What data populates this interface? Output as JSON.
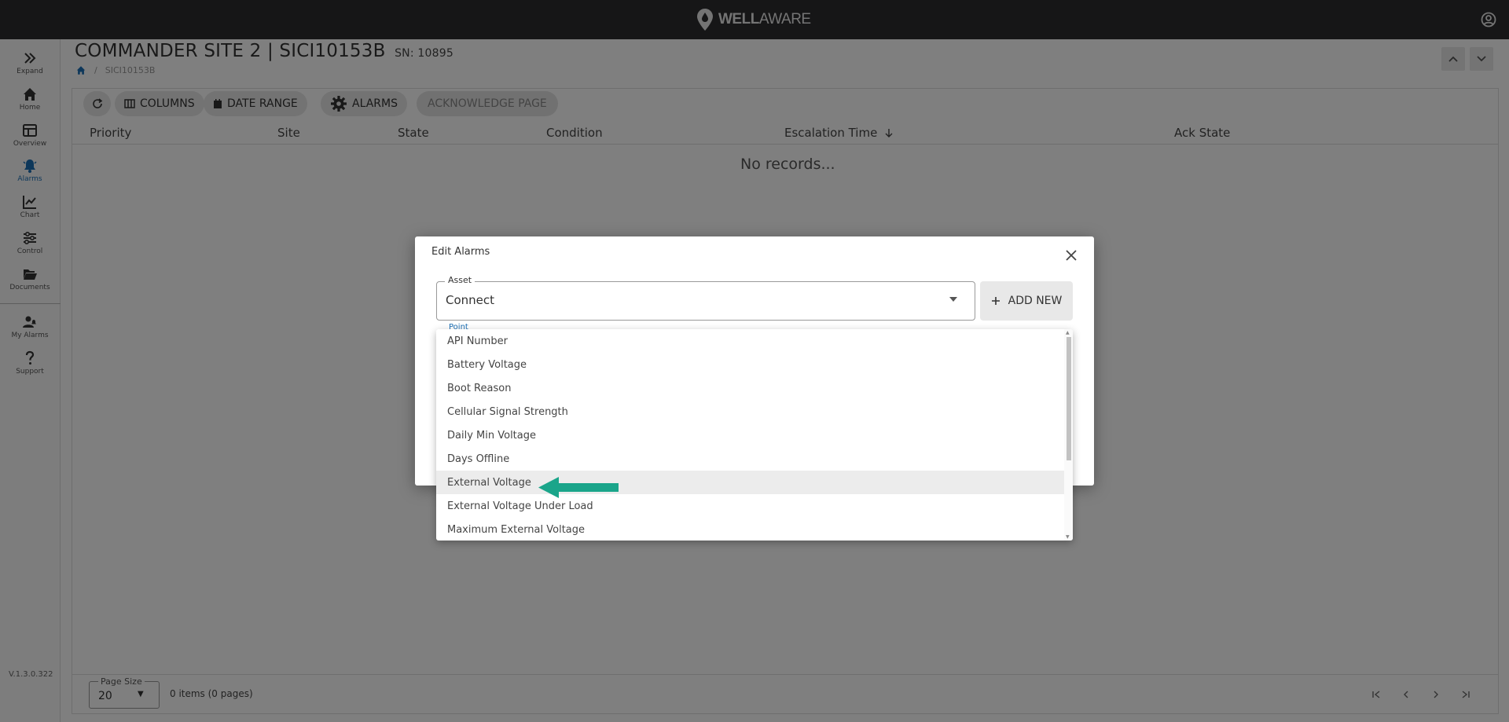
{
  "header": {
    "logo_text_a": "WELL",
    "logo_text_b": "AWARE"
  },
  "sidebar": {
    "items": [
      {
        "label": "Expand"
      },
      {
        "label": "Home"
      },
      {
        "label": "Overview"
      },
      {
        "label": "Alarms"
      },
      {
        "label": "Chart"
      },
      {
        "label": "Control"
      },
      {
        "label": "Documents"
      },
      {
        "label": "My Alarms"
      },
      {
        "label": "Support"
      }
    ],
    "version": "V.1.3.0.322"
  },
  "page": {
    "title": "COMMANDER SITE 2 | SICI10153B",
    "serial": "SN: 10895",
    "breadcrumb_sep": "/",
    "breadcrumb": "SICI10153B"
  },
  "toolbar": {
    "columns": "COLUMNS",
    "date_range": "DATE RANGE",
    "alarms": "ALARMS",
    "acknowledge": "ACKNOWLEDGE PAGE"
  },
  "table": {
    "headers": [
      "Priority",
      "Site",
      "State",
      "Condition",
      "Escalation Time",
      "Ack State"
    ],
    "empty": "No records..."
  },
  "footer": {
    "page_size_label": "Page Size",
    "page_size": "20",
    "items_info": "0 items (0 pages)"
  },
  "dialog": {
    "title": "Edit Alarms",
    "asset_label": "Asset",
    "asset_value": "Connect",
    "add_new": "ADD NEW",
    "point_label": "Point"
  },
  "dropdown": {
    "options": [
      "API Number",
      "Battery Voltage",
      "Boot Reason",
      "Cellular Signal Strength",
      "Daily Min Voltage",
      "Days Offline",
      "External Voltage",
      "External Voltage Under Load",
      "Maximum External Voltage"
    ],
    "highlighted": "External Voltage"
  },
  "colors": {
    "accent": "#1b6fb5",
    "annotation": "#1aa58a",
    "topbar": "#2d2d2f"
  }
}
